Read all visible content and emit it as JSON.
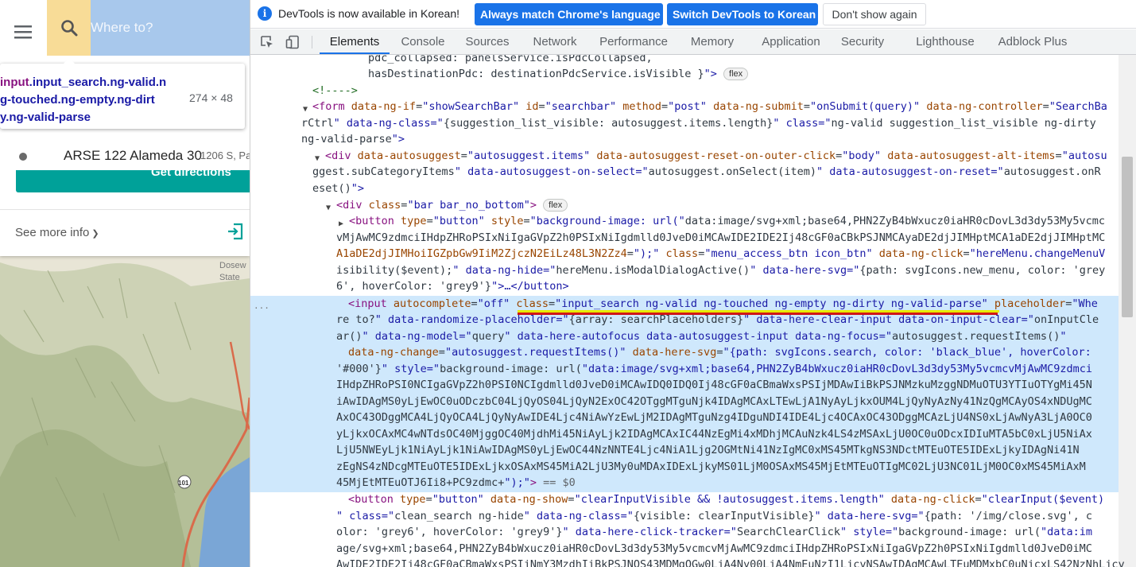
{
  "map_page": {
    "search_placeholder": "Where to?",
    "tooltip": {
      "selector_lines": [
        "input.input_search.ng-valid.n",
        "g-touched.ng-empty.ng-dirt",
        "y.ng-valid-parse"
      ],
      "tag_prefix": "input",
      "dimensions": "274 × 48"
    },
    "poi": {
      "name": "ARSE 122 Alameda 30",
      "address": "1206 S, Pa"
    },
    "directions_label": "Get directions",
    "see_more": "See more info",
    "map_label_line1": "Dosew",
    "map_label_line2": "State",
    "colors": {
      "search_icon_bg": "#f8dc97",
      "search_input_bg": "#a8c8ec",
      "accent_teal": "#00a199"
    }
  },
  "devtools": {
    "infobar": {
      "text": "DevTools is now available in Korean!",
      "match_button": "Always match Chrome's language",
      "switch_button": "Switch DevTools to Korean",
      "dont_show_button": "Don't show again"
    },
    "tabs": [
      "Elements",
      "Console",
      "Sources",
      "Network",
      "Performance",
      "Memory",
      "Application",
      "Security",
      "Lighthouse",
      "Adblock Plus"
    ],
    "active_tab": "Elements",
    "flex_badge": "flex",
    "selected_suffix": "== $0",
    "ellipsis": "...",
    "lines": [
      "pdc_collapsed: panelsService.isPdcCollapsed,",
      "hasDestinationPdc: destinationPdcService.isVisible }\">",
      "<!---->",
      "<form data-ng-if=\"showSearchBar\" id=\"searchbar\" method=\"post\" data-ng-submit=\"onSubmit(query)\" data-ng-controller=\"SearchBa",
      "rCtrl\" data-ng-class=\"{suggestion_list_visible: autosuggest.items.length}\" class=\"ng-valid suggestion_list_visible ng-dirty",
      "ng-valid-parse\">",
      "<div data-autosuggest=\"autosuggest.items\" data-autosuggest-reset-on-outer-click=\"body\" data-autosuggest-alt-items=\"autosu",
      "ggest.subCategoryItems\" data-autosuggest-on-select=\"autosuggest.onSelect(item)\" data-autosuggest-on-reset=\"autosuggest.onR",
      "eset()\">",
      "<div class=\"bar bar_no_bottom\">",
      "<button type=\"button\" style=\"background-image: url(\"data:image/svg+xml;base64,PHN2ZyB4bWxucz0iaHR0cDovL3d3dy53My5vcmc",
      "vMjAwMC9zdmciIHdpZHRoPSIxNiIgaGVpZ2h0PSIxNiIgdmlld0JveD0iMCAwIDE2IDE2Ij48cGF0aCBkPSJNMCAyaDE2djJIMHptMCA1aDE2djJIMHptMC",
      "A1aDE2djJIMHoiIGZpbGw9IiM2ZjczN2EiLz48L3N2Zz4=\");\" class=\"menu_access_btn icon_btn\" data-ng-click=\"hereMenu.changeMenuV",
      "isibility($event);\" data-ng-hide=\"hereMenu.isModalDialogActive()\" data-here-svg=\"{path: svgIcons.new_menu, color: 'grey",
      "6', hoverColor: 'grey9'}\">…</button>",
      "<input autocomplete=\"off\" class=\"input_search ng-valid ng-touched ng-empty ng-dirty ng-valid-parse\" placeholder=\"Whe",
      "re to?\" data-randomize-placeholder=\"{array: searchPlaceholders}\" data-here-clear-input data-on-input-clear=\"onInputCle",
      "ar()\" data-ng-model=\"query\" data-here-autofocus data-autosuggest-input data-ng-focus=\"autosuggest.requestItems()\"",
      "data-ng-change=\"autosuggest.requestItems()\" data-here-svg=\"{path: svgIcons.search, color: 'black_blue', hoverColor:",
      "'#000'}\" style=\"background-image: url(\"data:image/svg+xml;base64,PHN2ZyB4bWxucz0iaHR0cDovL3d3dy53My5vcmcvMjAwMC9zdmci",
      "IHdpZHRoPSI0NCIgaGVpZ2h0PSI0NCIgdmlld0JveD0iMCAwIDQ0IDQ0Ij48cGF0aCBmaWxsPSIjMDAwIiBkPSJNMzkuMzggNDMuOTU3YTIuOTYgMi45N",
      "iAwIDAgMS0yLjEwOC0uODczbC04LjQyOS04LjQyN2ExOC42OTggMTguNjk4IDAgMCAxLTEwLjA1NyAyLjkxOUM4LjQyNyAzNy41NzQgMCAyOS4xNDUgMC",
      "AxOC43ODggMCA4LjQyOCA4LjQyNyAwIDE4Ljc4NiAwYzEwLjM2IDAgMTguNzg4IDguNDI4IDE4Ljc4OCAxOC43ODggMCAzLjU4NS0xLjAwNyA3LjA0OC0",
      "yLjkxOCAxMC4wNTdsOC40MjggOC40MjdhMi45NiAyLjk2IDAgMCAxIC44NzEgMi4xMDhjMCAuNzk4LS4zMSAxLjU0OC0uODcxIDIuMTA5bC0xLjU5NiAx",
      "LjU5NWEyLjk1NiAyLjk1NiAwIDAgMS0yLjEwOC44NzNNTE4Ljc4NiA1Ljg2OGMtNi41NzIgMC0xMS45MTkgNS3NDctMTEuOTE5IDExLjkyIDAgNi41N",
      "zEgNS4zNDcgMTEuOTE5IDExLjkxOSAxMS45MiA2LjU3My0uMDAxIDExLjkyMS01LjM0OSAxMS45MjEtMTEuOTIgMC02LjU3NC01LjM0OC0xMS45MiAxM",
      "45MjEtMTEuOTJ6Ii8+PC9zdmc+\");\">",
      "<button type=\"button\" data-ng-show=\"clearInputVisible && !autosuggest.items.length\" data-ng-click=\"clearInput($event)",
      "\" class=\"clean_search ng-hide\" data-ng-class=\"{visible: clearInputVisible}\" data-here-svg=\"{path: '/img/close.svg', c",
      "olor: 'grey6', hoverColor: 'grey9'}\" data-here-click-tracker=\"SearchClearClick\" style=\"background-image: url(\"data:im",
      "age/svg+xml;base64,PHN2ZyB4bWxucz0iaHR0cDovL3d3dy53My5vcmcvMjAwMC9zdmciIHdpZHRoPSIxNiIgaGVpZ2h0PSIxNiIgdmlld0JveD0iMC",
      "AwIDE2IDE2Ij48cGF0aCBmaWxsPSIjNmY3MzdhIiBkPSJNOS43MDMgOGw0LjA4Ny00LjA4NmEuNzI1LjcyNSAwIDAgMCAwLTEuMDMxbC0uNjcxLS42NzNhLjcy"
    ]
  }
}
